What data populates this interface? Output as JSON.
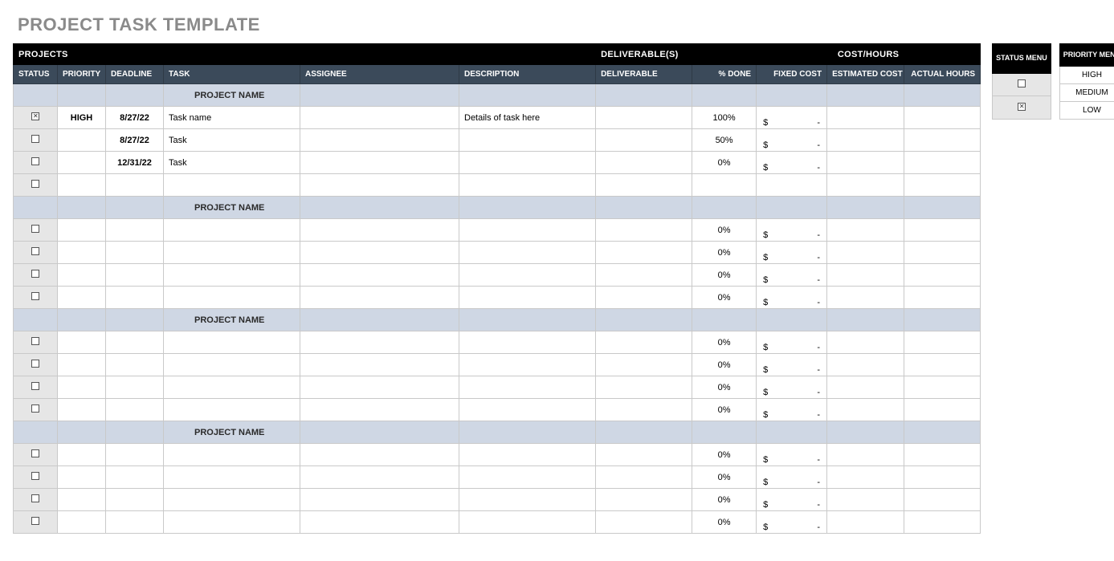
{
  "title": "PROJECT TASK TEMPLATE",
  "topHeader": {
    "projects": "PROJECTS",
    "deliverables": "DELIVERABLE(S)",
    "costHours": "COST/HOURS"
  },
  "columns": {
    "status": "STATUS",
    "priority": "PRIORITY",
    "deadline": "DEADLINE",
    "task": "TASK",
    "assignee": "ASSIGNEE",
    "description": "DESCRIPTION",
    "deliverable": "DELIVERABLE",
    "done": "% DONE",
    "fixedCost": "FIXED COST",
    "estimatedCost": "ESTIMATED COST",
    "actualHours": "ACTUAL HOURS"
  },
  "fixedCost": {
    "symbol": "$",
    "dash": "-"
  },
  "groups": [
    {
      "name": "PROJECT NAME",
      "rows": [
        {
          "checked": true,
          "priority": "HIGH",
          "deadline": "8/27/22",
          "task": "Task name",
          "assignee": "",
          "description": "Details of task here",
          "deliverable": "",
          "done": "100%",
          "fixedCost": true,
          "est": "",
          "actual": ""
        },
        {
          "checked": false,
          "priority": "",
          "deadline": "8/27/22",
          "task": "Task",
          "assignee": "",
          "description": "",
          "deliverable": "",
          "done": "50%",
          "fixedCost": true,
          "est": "",
          "actual": ""
        },
        {
          "checked": false,
          "priority": "",
          "deadline": "12/31/22",
          "task": "Task",
          "assignee": "",
          "description": "",
          "deliverable": "",
          "done": "0%",
          "fixedCost": true,
          "est": "",
          "actual": ""
        },
        {
          "checked": false,
          "priority": "",
          "deadline": "",
          "task": "",
          "assignee": "",
          "description": "",
          "deliverable": "",
          "done": "",
          "fixedCost": false,
          "est": "",
          "actual": ""
        }
      ]
    },
    {
      "name": "PROJECT NAME",
      "rows": [
        {
          "checked": false,
          "priority": "",
          "deadline": "",
          "task": "",
          "assignee": "",
          "description": "",
          "deliverable": "",
          "done": "0%",
          "fixedCost": true,
          "est": "",
          "actual": ""
        },
        {
          "checked": false,
          "priority": "",
          "deadline": "",
          "task": "",
          "assignee": "",
          "description": "",
          "deliverable": "",
          "done": "0%",
          "fixedCost": true,
          "est": "",
          "actual": ""
        },
        {
          "checked": false,
          "priority": "",
          "deadline": "",
          "task": "",
          "assignee": "",
          "description": "",
          "deliverable": "",
          "done": "0%",
          "fixedCost": true,
          "est": "",
          "actual": ""
        },
        {
          "checked": false,
          "priority": "",
          "deadline": "",
          "task": "",
          "assignee": "",
          "description": "",
          "deliverable": "",
          "done": "0%",
          "fixedCost": true,
          "est": "",
          "actual": ""
        }
      ]
    },
    {
      "name": "PROJECT NAME",
      "rows": [
        {
          "checked": false,
          "priority": "",
          "deadline": "",
          "task": "",
          "assignee": "",
          "description": "",
          "deliverable": "",
          "done": "0%",
          "fixedCost": true,
          "est": "",
          "actual": ""
        },
        {
          "checked": false,
          "priority": "",
          "deadline": "",
          "task": "",
          "assignee": "",
          "description": "",
          "deliverable": "",
          "done": "0%",
          "fixedCost": true,
          "est": "",
          "actual": ""
        },
        {
          "checked": false,
          "priority": "",
          "deadline": "",
          "task": "",
          "assignee": "",
          "description": "",
          "deliverable": "",
          "done": "0%",
          "fixedCost": true,
          "est": "",
          "actual": ""
        },
        {
          "checked": false,
          "priority": "",
          "deadline": "",
          "task": "",
          "assignee": "",
          "description": "",
          "deliverable": "",
          "done": "0%",
          "fixedCost": true,
          "est": "",
          "actual": ""
        }
      ]
    },
    {
      "name": "PROJECT NAME",
      "rows": [
        {
          "checked": false,
          "priority": "",
          "deadline": "",
          "task": "",
          "assignee": "",
          "description": "",
          "deliverable": "",
          "done": "0%",
          "fixedCost": true,
          "est": "",
          "actual": ""
        },
        {
          "checked": false,
          "priority": "",
          "deadline": "",
          "task": "",
          "assignee": "",
          "description": "",
          "deliverable": "",
          "done": "0%",
          "fixedCost": true,
          "est": "",
          "actual": ""
        },
        {
          "checked": false,
          "priority": "",
          "deadline": "",
          "task": "",
          "assignee": "",
          "description": "",
          "deliverable": "",
          "done": "0%",
          "fixedCost": true,
          "est": "",
          "actual": ""
        },
        {
          "checked": false,
          "priority": "",
          "deadline": "",
          "task": "",
          "assignee": "",
          "description": "",
          "deliverable": "",
          "done": "0%",
          "fixedCost": true,
          "est": "",
          "actual": ""
        }
      ]
    }
  ],
  "statusMenu": {
    "title": "STATUS MENU",
    "items": [
      {
        "checked": false
      },
      {
        "checked": true
      }
    ]
  },
  "priorityMenu": {
    "title": "PRIORITY MENU",
    "items": [
      "HIGH",
      "MEDIUM",
      "LOW"
    ]
  }
}
